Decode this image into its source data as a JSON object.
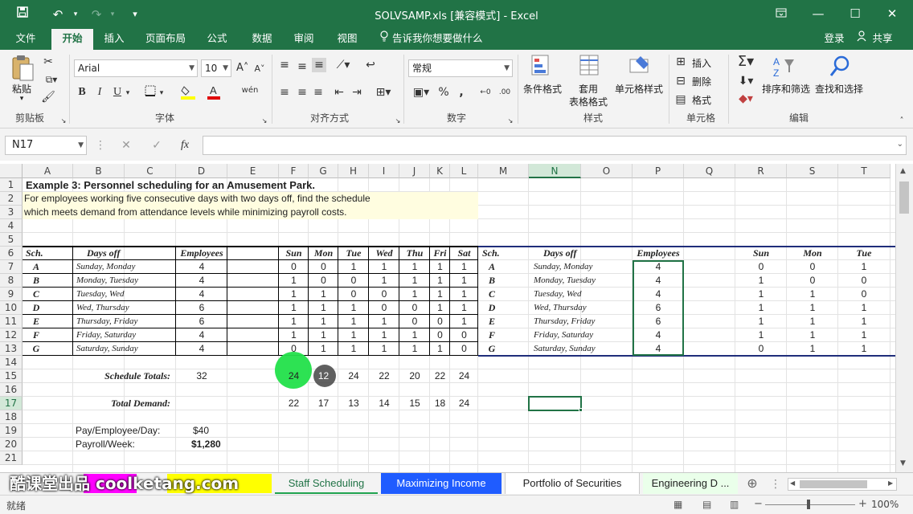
{
  "window": {
    "title": "SOLVSAMP.xls  [兼容模式] - Excel",
    "save_icon": "save-icon",
    "undo_icon": "undo-icon",
    "redo_icon": "redo-icon"
  },
  "menu": {
    "items": [
      "文件",
      "开始",
      "插入",
      "页面布局",
      "公式",
      "数据",
      "审阅",
      "视图"
    ],
    "active": "开始",
    "tell_me": "告诉我你想要做什么",
    "login": "登录",
    "share": "共享"
  },
  "ribbon": {
    "clipboard": {
      "paste": "粘贴",
      "label": "剪贴板"
    },
    "font": {
      "name": "Arial",
      "size": "10",
      "bold": "B",
      "italic": "I",
      "underline": "U",
      "label": "字体"
    },
    "alignment": {
      "label": "对齐方式"
    },
    "number": {
      "format": "常规",
      "label": "数字"
    },
    "styles": {
      "conditional": "条件格式",
      "table_line1": "套用",
      "table_line2": "表格格式",
      "cell_styles": "单元格样式",
      "label": "样式"
    },
    "cells": {
      "insert": "插入",
      "delete": "删除",
      "format": "格式",
      "label": "单元格"
    },
    "editing": {
      "sort": "排序和筛选",
      "find": "查找和选择",
      "label": "编辑"
    }
  },
  "formula_bar": {
    "name_box": "N17",
    "fx": "fx",
    "formula": ""
  },
  "grid": {
    "columns": [
      "A",
      "B",
      "C",
      "D",
      "E",
      "F",
      "G",
      "H",
      "I",
      "J",
      "K",
      "L",
      "M",
      "N",
      "O",
      "P",
      "Q",
      "R",
      "S",
      "T"
    ],
    "selected_column": "N",
    "rows": [
      "1",
      "2",
      "3",
      "4",
      "5",
      "6",
      "7",
      "8",
      "9",
      "10",
      "11",
      "12",
      "13",
      "14",
      "15",
      "16",
      "17",
      "18",
      "19",
      "20",
      "21"
    ],
    "selected_row": "17",
    "title": "Example 3:  Personnel scheduling for an Amusement Park.",
    "desc1": "For employees working five consecutive days with two days off, find the schedule",
    "desc2": "which meets demand from attendance levels while minimizing payroll costs.",
    "headers": {
      "sch": "Sch.",
      "days_off": "Days off",
      "employees": "Employees",
      "days": [
        "Sun",
        "Mon",
        "Tue",
        "Wed",
        "Thu",
        "Fri",
        "Sat"
      ]
    },
    "schedule": [
      {
        "sch": "A",
        "off": "Sunday, Monday",
        "emp": "4",
        "d": [
          "0",
          "0",
          "1",
          "1",
          "1",
          "1",
          "1"
        ]
      },
      {
        "sch": "B",
        "off": "Monday, Tuesday",
        "emp": "4",
        "d": [
          "1",
          "0",
          "0",
          "1",
          "1",
          "1",
          "1"
        ]
      },
      {
        "sch": "C",
        "off": "Tuesday, Wed",
        "emp": "4",
        "d": [
          "1",
          "1",
          "0",
          "0",
          "1",
          "1",
          "1"
        ]
      },
      {
        "sch": "D",
        "off": "Wed, Thursday",
        "emp": "6",
        "d": [
          "1",
          "1",
          "1",
          "0",
          "0",
          "1",
          "1"
        ]
      },
      {
        "sch": "E",
        "off": "Thursday, Friday",
        "emp": "6",
        "d": [
          "1",
          "1",
          "1",
          "1",
          "0",
          "0",
          "1"
        ]
      },
      {
        "sch": "F",
        "off": "Friday, Saturday",
        "emp": "4",
        "d": [
          "1",
          "1",
          "1",
          "1",
          "1",
          "0",
          "0"
        ]
      },
      {
        "sch": "G",
        "off": "Saturday, Sunday",
        "emp": "4",
        "d": [
          "0",
          "1",
          "1",
          "1",
          "1",
          "1",
          "0"
        ]
      }
    ],
    "copy_days": [
      "Sun",
      "Mon",
      "Tue"
    ],
    "schedule_totals_label": "Schedule Totals:",
    "schedule_totals": [
      "32",
      "24",
      "12",
      "24",
      "22",
      "20",
      "22",
      "24"
    ],
    "total_demand_label": "Total Demand:",
    "total_demand": [
      "22",
      "17",
      "13",
      "14",
      "15",
      "18",
      "24"
    ],
    "pay_label": "Pay/Employee/Day:",
    "pay_value": "$40",
    "payroll_label": "Payroll/Week:",
    "payroll_value": "$1,280"
  },
  "sheet_tabs": {
    "watermark": "酷课堂出品 coolketang.com",
    "tabs": [
      "Staff Scheduling",
      "Maximizing Income",
      "Portfolio of Securities",
      "Engineering D ..."
    ],
    "active": "Portfolio of Securities",
    "colors": {
      "Staff Scheduling": "#f3f3f3",
      "Maximizing Income": "#1f5cff",
      "Engineering D ...": "#eaffea"
    }
  },
  "status": {
    "ready": "就绪",
    "zoom": "100%"
  },
  "colors": {
    "accent": "#217346",
    "click_highlight": "#22e04a",
    "table_border": "#1f2d7a"
  }
}
